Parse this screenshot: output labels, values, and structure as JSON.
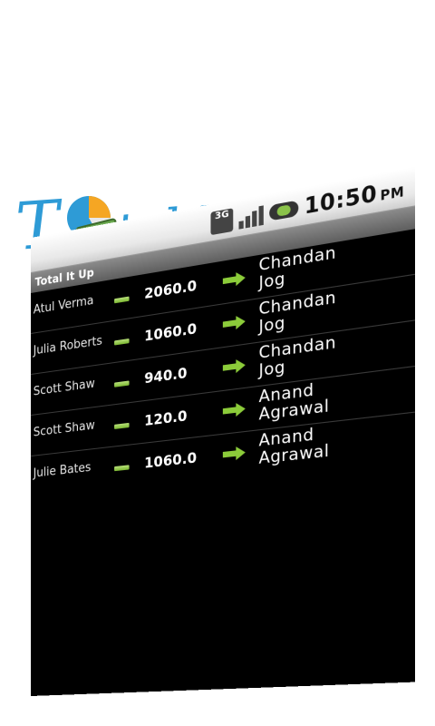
{
  "logo": {
    "text_t": "T",
    "text_rest": "tal It Up!"
  },
  "status_bar": {
    "network_label": "3G",
    "time": "10:50",
    "ampm": "PM",
    "colors": {
      "battery": "#8bc34a"
    }
  },
  "app": {
    "title": "Total It Up"
  },
  "transactions": [
    {
      "payer": "Atul Verma",
      "amount": "2060.0",
      "payee": "Chandan Jog"
    },
    {
      "payer": "Julia Roberts",
      "amount": "1060.0",
      "payee": "Chandan Jog"
    },
    {
      "payer": "Scott Shaw",
      "amount": "940.0",
      "payee": "Chandan Jog"
    },
    {
      "payer": "Scott Shaw",
      "amount": "120.0",
      "payee": "Anand Agrawal"
    },
    {
      "payer": "Julie Bates",
      "amount": "1060.0",
      "payee": "Anand Agrawal"
    }
  ],
  "colors": {
    "logo_blue": "#2e9bd6",
    "accent_green": "#8ccc3a"
  }
}
